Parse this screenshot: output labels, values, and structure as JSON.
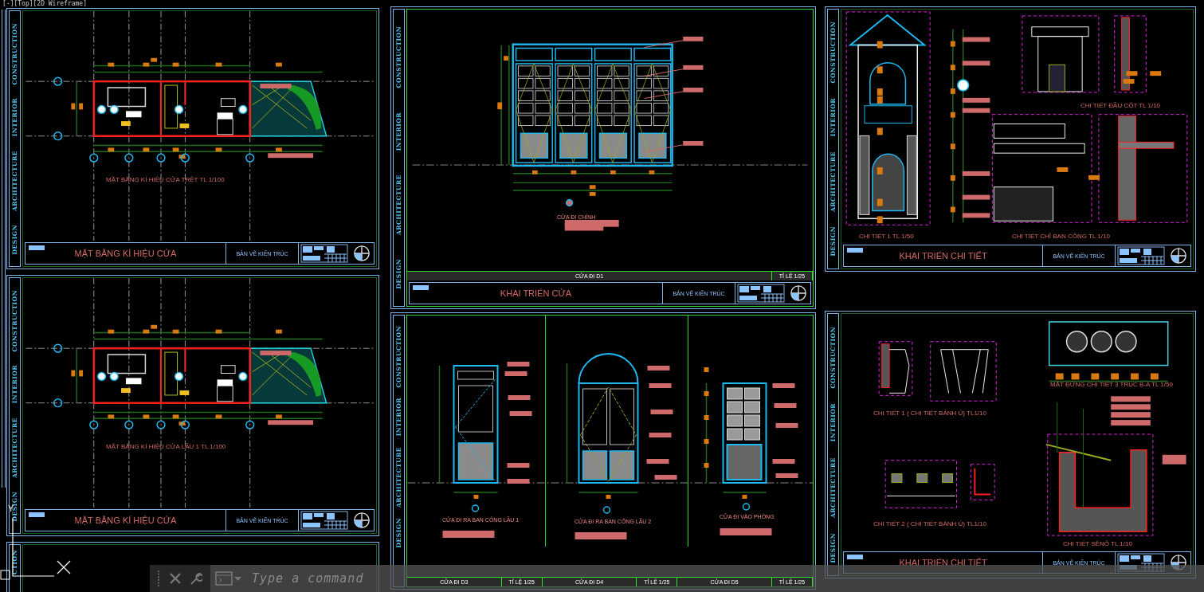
{
  "viewport": {
    "label": "[-][Top][2D Wireframe]"
  },
  "sheets": [
    {
      "kind": "plan",
      "side_labels": [
        "DESIGN",
        "ARCHITECTURE",
        "INTERIOR",
        "CONSTRUCTION"
      ],
      "captions": [
        "MẶT BẰNG KÍ HIỆU CỬA TRỆT TL 1/100"
      ],
      "title": "MẶT BẰNG KÍ HIỆU CỬA",
      "subtitle": "BẢN VẼ KIẾN TRÚC"
    },
    {
      "kind": "plan",
      "side_labels": [
        "DESIGN",
        "ARCHITECTURE",
        "INTERIOR",
        "CONSTRUCTION"
      ],
      "captions": [
        "MẶT BẰNG KÍ HIỆU CỬA LẦU 1 TL 1/100"
      ],
      "title": "MẶT BẰNG KÍ HIỆU CỬA",
      "subtitle": "BẢN VẼ KIẾN TRÚC"
    },
    {
      "kind": "door",
      "side_labels": [
        "DESIGN",
        "ARCHITECTURE",
        "INTERIOR",
        "CONSTRUCTION"
      ],
      "captions": [
        "CỬA ĐI CHÍNH"
      ],
      "footer": [
        {
          "label": "CỬA ĐI D1",
          "scale": "TỈ LỆ 1/25"
        }
      ],
      "title": "KHAI TRIỂN CỬA",
      "subtitle": "BẢN VẼ KIẾN TRÚC"
    },
    {
      "kind": "doors",
      "side_labels": [
        "DESIGN",
        "ARCHITECTURE",
        "INTERIOR",
        "CONSTRUCTION"
      ],
      "captions": [
        "CỬA ĐI RA BAN CÔNG LẦU 1",
        "CỬA ĐI RA BAN CÔNG LẦU 2",
        "CỬA ĐI VÀO PHÒNG"
      ],
      "footer": [
        {
          "label": "CỬA ĐI D3",
          "scale": "TỈ LỆ 1/25"
        },
        {
          "label": "CỬA ĐI D4",
          "scale": "TỈ LỆ 1/25"
        },
        {
          "label": "CỬA ĐI D5",
          "scale": "TỈ LỆ 1/25"
        }
      ]
    },
    {
      "kind": "details",
      "side_labels": [
        "DESIGN",
        "ARCHITECTURE",
        "INTERIOR",
        "CONSTRUCTION"
      ],
      "captions": [
        "CHI TIẾT 1 TL 1/50",
        "CHI TIẾT ĐẦU CỘT TL 1/10",
        "CHI TIẾT CHỈ BAN CÔNG TL 1/10"
      ],
      "title": "KHAI TRIỂN CHI TIẾT",
      "subtitle": "BẢN VẼ KIẾN TRÚC"
    },
    {
      "kind": "details2",
      "side_labels": [
        "DESIGN",
        "ARCHITECTURE",
        "INTERIOR",
        "CONSTRUCTION"
      ],
      "captions": [
        "CHI TIẾT 1 ( CHI TIẾT BÁNH Ú) TL1/10",
        "MẶT ĐỨNG CHI TIẾT 3 TRỤC B-A TL 1/50",
        "CHI TIẾT 2 ( CHI TIẾT BÁNH Ú) TL1/10",
        "CHI TIẾT SÊNÔ TL 1/10"
      ],
      "title": "KHAI TRIỂN CHI TIẾT",
      "subtitle": "BẢN VẼ KIẾN TRÚC"
    },
    {
      "kind": "partial",
      "side_labels": [
        "CTION"
      ]
    }
  ],
  "ucs": {
    "axis_label": "Y"
  },
  "command_line": {
    "placeholder": "Type a command"
  }
}
